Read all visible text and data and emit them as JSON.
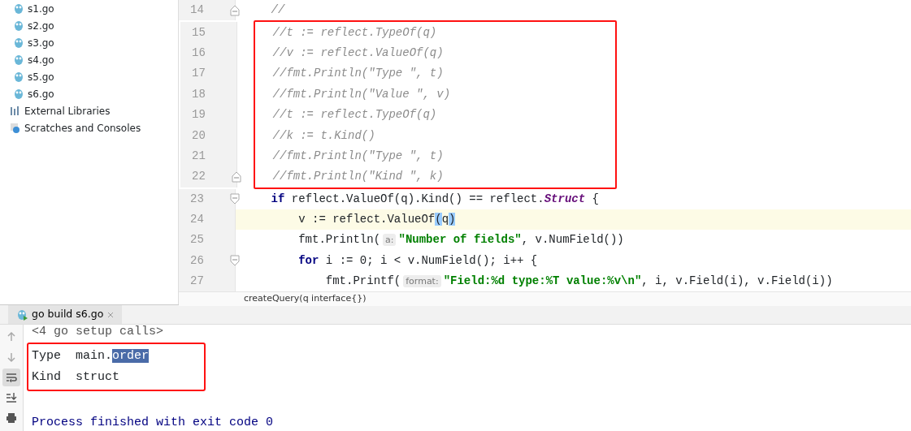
{
  "project_tree": {
    "items": [
      {
        "label": "s1.go",
        "kind": "go-file"
      },
      {
        "label": "s2.go",
        "kind": "go-file"
      },
      {
        "label": "s3.go",
        "kind": "go-file"
      },
      {
        "label": "s4.go",
        "kind": "go-file"
      },
      {
        "label": "s5.go",
        "kind": "go-file"
      },
      {
        "label": "s6.go",
        "kind": "go-file"
      },
      {
        "label": "External Libraries",
        "kind": "libraries"
      },
      {
        "label": "Scratches and Consoles",
        "kind": "scratches"
      }
    ]
  },
  "editor": {
    "blocks": [
      {
        "boxed": false,
        "lines": [
          {
            "number": "14",
            "kind": "fold-end",
            "current": false,
            "tokens": [
              {
                "text": "    //",
                "kind": "comment"
              }
            ]
          }
        ]
      },
      {
        "boxed": true,
        "lines": [
          {
            "number": "15",
            "kind": "code",
            "current": false,
            "tokens": [
              {
                "text": "    //t := reflect.TypeOf(q)",
                "kind": "comment"
              }
            ]
          },
          {
            "number": "16",
            "kind": "code",
            "current": false,
            "tokens": [
              {
                "text": "    //v := reflect.ValueOf(q)",
                "kind": "comment"
              }
            ]
          },
          {
            "number": "17",
            "kind": "code",
            "current": false,
            "tokens": [
              {
                "text": "    //fmt.Println(\"Type \", t)",
                "kind": "comment"
              }
            ]
          },
          {
            "number": "18",
            "kind": "code",
            "current": false,
            "tokens": [
              {
                "text": "    //fmt.Println(\"Value \", v)",
                "kind": "comment"
              }
            ]
          },
          {
            "number": "19",
            "kind": "code",
            "current": false,
            "tokens": [
              {
                "text": "    //t := reflect.TypeOf(q)",
                "kind": "comment"
              }
            ]
          },
          {
            "number": "20",
            "kind": "code",
            "current": false,
            "tokens": [
              {
                "text": "    //k := t.Kind()",
                "kind": "comment"
              }
            ]
          },
          {
            "number": "21",
            "kind": "code",
            "current": false,
            "tokens": [
              {
                "text": "    //fmt.Println(\"Type \", t)",
                "kind": "comment"
              }
            ]
          },
          {
            "number": "22",
            "kind": "fold-end",
            "current": false,
            "tokens": [
              {
                "text": "    //fmt.Println(\"Kind \", k)",
                "kind": "comment"
              }
            ]
          }
        ]
      },
      {
        "boxed": false,
        "lines": [
          {
            "number": "23",
            "kind": "fold-start",
            "current": false,
            "tokens": [
              {
                "text": "    if",
                "kind": "keyword"
              },
              {
                "text": " reflect.ValueOf(q).Kind() == reflect.",
                "kind": "plain"
              },
              {
                "text": "Struct",
                "kind": "type"
              },
              {
                "text": " {",
                "kind": "plain"
              }
            ]
          },
          {
            "number": "24",
            "kind": "code",
            "current": true,
            "tokens": [
              {
                "text": "        v := reflect.ValueOf",
                "kind": "plain"
              },
              {
                "text": "(",
                "kind": "match"
              },
              {
                "text": "q",
                "kind": "plain"
              },
              {
                "text": ")",
                "kind": "match"
              }
            ]
          },
          {
            "number": "25",
            "kind": "code",
            "current": false,
            "tokens": [
              {
                "text": "        fmt.Println(",
                "kind": "plain"
              },
              {
                "text": "a:",
                "kind": "hint"
              },
              {
                "text": "\"Number of fields\"",
                "kind": "string"
              },
              {
                "text": ", v.NumField())",
                "kind": "plain"
              }
            ]
          },
          {
            "number": "26",
            "kind": "fold-start",
            "current": false,
            "tokens": [
              {
                "text": "        for",
                "kind": "keyword"
              },
              {
                "text": " i := 0; i < v.NumField(); i++ {",
                "kind": "plain"
              }
            ]
          },
          {
            "number": "27",
            "kind": "code",
            "current": false,
            "tokens": [
              {
                "text": "            fmt.Printf(",
                "kind": "plain"
              },
              {
                "text": "format:",
                "kind": "hint"
              },
              {
                "text": "\"Field:%d type:%T value:%v\\n\"",
                "kind": "string"
              },
              {
                "text": ", i, v.Field(i), v.Field(i))",
                "kind": "plain"
              }
            ]
          }
        ]
      }
    ],
    "breadcrumb": "createQuery(q interface{})"
  },
  "run_panel": {
    "tabs": [
      {
        "label": "go build s6.go",
        "selected": true
      }
    ],
    "toolbar": [
      {
        "kind": "up",
        "selected": false
      },
      {
        "kind": "down",
        "selected": false
      },
      {
        "kind": "wrap",
        "selected": true
      },
      {
        "kind": "scroll-end",
        "selected": false
      },
      {
        "kind": "print",
        "selected": false
      }
    ],
    "output_blocks": [
      {
        "boxed": false,
        "lines": [
          {
            "kind": "folded",
            "spans": [
              {
                "text": "<4 go setup calls>",
                "selected": false
              }
            ]
          }
        ]
      },
      {
        "boxed": true,
        "lines": [
          {
            "kind": "stdout",
            "spans": [
              {
                "text": "Type  main.",
                "selected": false
              },
              {
                "text": "order",
                "selected": true
              }
            ]
          },
          {
            "kind": "stdout",
            "spans": [
              {
                "text": "Kind  struct",
                "selected": false
              }
            ]
          }
        ]
      },
      {
        "boxed": false,
        "lines": [
          {
            "kind": "system",
            "spans": [
              {
                "text": "Process finished with exit code 0",
                "selected": false
              }
            ]
          }
        ]
      }
    ]
  }
}
